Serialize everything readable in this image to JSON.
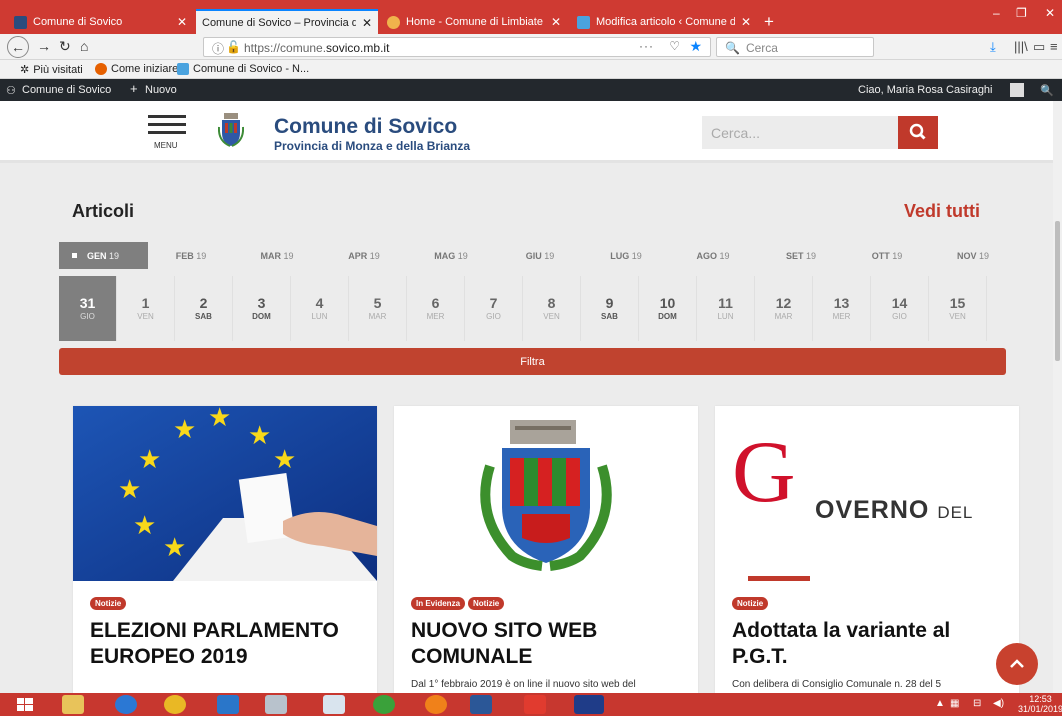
{
  "browser": {
    "tabs": [
      {
        "title": "Comune di Sovico",
        "color": "#2a4c7e",
        "active": false
      },
      {
        "title": "Comune di Sovico – Provincia di Monza e della Brianza",
        "color": "#e0e0e0",
        "active": true
      },
      {
        "title": "Home - Comune di Limbiate",
        "color": "#f0b34c",
        "active": false
      },
      {
        "title": "Modifica articolo ‹ Comune di Sovico",
        "color": "#4aa3df",
        "active": false
      }
    ],
    "tab_close": "✕",
    "new_tab": "+",
    "url_prefix": "https://comune.",
    "url_domain": "sovico.mb.it",
    "url_more": "···",
    "search_placeholder": "Cerca",
    "bookmarks": [
      "Più visitati",
      "Come iniziare",
      "Comune di Sovico - N..."
    ]
  },
  "adminbar": {
    "site": "Comune di Sovico",
    "new": "Nuovo",
    "greeting": "Ciao, Maria Rosa Casiraghi"
  },
  "header": {
    "menu_label": "MENU",
    "title": "Comune di Sovico",
    "subtitle": "Provincia di Monza e della Brianza",
    "search_placeholder": "Cerca..."
  },
  "section": {
    "title": "Articoli",
    "see_all": "Vedi tutti",
    "filter": "Filtra"
  },
  "months": [
    {
      "name": "GEN",
      "year": "19",
      "active": true
    },
    {
      "name": "FEB",
      "year": "19"
    },
    {
      "name": "MAR",
      "year": "19"
    },
    {
      "name": "APR",
      "year": "19"
    },
    {
      "name": "MAG",
      "year": "19"
    },
    {
      "name": "GIU",
      "year": "19"
    },
    {
      "name": "LUG",
      "year": "19"
    },
    {
      "name": "AGO",
      "year": "19"
    },
    {
      "name": "SET",
      "year": "19"
    },
    {
      "name": "OTT",
      "year": "19"
    },
    {
      "name": "NOV",
      "year": "19"
    }
  ],
  "days": [
    {
      "num": "31",
      "dow": "GIO",
      "active": true
    },
    {
      "num": "1",
      "dow": "VEN"
    },
    {
      "num": "2",
      "dow": "SAB",
      "weekend": true
    },
    {
      "num": "3",
      "dow": "DOM",
      "weekend": true
    },
    {
      "num": "4",
      "dow": "LUN"
    },
    {
      "num": "5",
      "dow": "MAR"
    },
    {
      "num": "6",
      "dow": "MER"
    },
    {
      "num": "7",
      "dow": "GIO"
    },
    {
      "num": "8",
      "dow": "VEN"
    },
    {
      "num": "9",
      "dow": "SAB",
      "weekend": true
    },
    {
      "num": "10",
      "dow": "DOM",
      "weekend": true
    },
    {
      "num": "11",
      "dow": "LUN"
    },
    {
      "num": "12",
      "dow": "MAR"
    },
    {
      "num": "13",
      "dow": "MER"
    },
    {
      "num": "14",
      "dow": "GIO"
    },
    {
      "num": "15",
      "dow": "VEN"
    }
  ],
  "cards": [
    {
      "badges": [
        "Notizie"
      ],
      "title": "ELEZIONI PARLAMENTO EUROPEO 2019",
      "excerpt": ""
    },
    {
      "badges": [
        "In Evidenza",
        "Notizie"
      ],
      "title": "NUOVO SITO WEB COMUNALE",
      "excerpt": "Dal 1° febbraio 2019 è on line il nuovo sito web del"
    },
    {
      "badges": [
        "Notizie"
      ],
      "title": "Adottata la variante al P.G.T.",
      "excerpt": "Con delibera di Consiglio Comunale n. 28 del 5"
    }
  ],
  "gov_logo": {
    "g": "G",
    "rest": "OVERNO",
    "small": "DEL"
  },
  "taskbar": {
    "time": "12:53",
    "date": "31/01/2019"
  },
  "colors": {
    "brand_red": "#c0392b",
    "brand_blue": "#2a4c7e",
    "browser_red": "#cf3a32"
  }
}
